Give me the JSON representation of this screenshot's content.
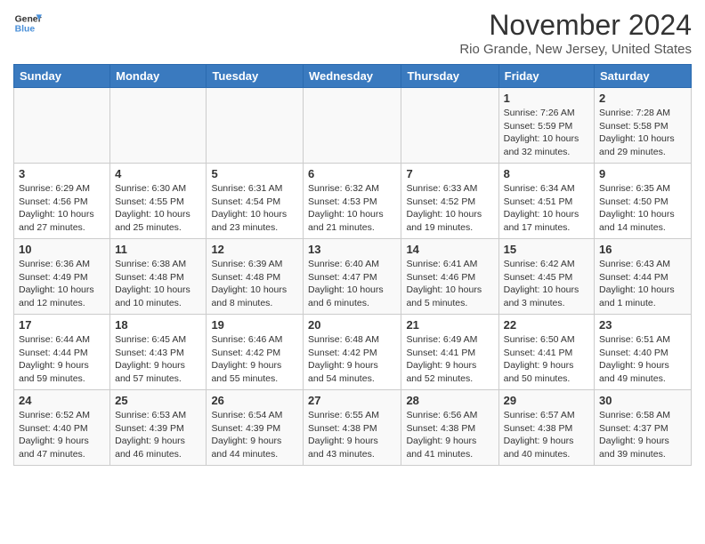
{
  "logo": {
    "line1": "General",
    "line2": "Blue"
  },
  "title": "November 2024",
  "location": "Rio Grande, New Jersey, United States",
  "days_header": [
    "Sunday",
    "Monday",
    "Tuesday",
    "Wednesday",
    "Thursday",
    "Friday",
    "Saturday"
  ],
  "weeks": [
    [
      {
        "day": "",
        "info": ""
      },
      {
        "day": "",
        "info": ""
      },
      {
        "day": "",
        "info": ""
      },
      {
        "day": "",
        "info": ""
      },
      {
        "day": "",
        "info": ""
      },
      {
        "day": "1",
        "info": "Sunrise: 7:26 AM\nSunset: 5:59 PM\nDaylight: 10 hours\nand 32 minutes."
      },
      {
        "day": "2",
        "info": "Sunrise: 7:28 AM\nSunset: 5:58 PM\nDaylight: 10 hours\nand 29 minutes."
      }
    ],
    [
      {
        "day": "3",
        "info": "Sunrise: 6:29 AM\nSunset: 4:56 PM\nDaylight: 10 hours\nand 27 minutes."
      },
      {
        "day": "4",
        "info": "Sunrise: 6:30 AM\nSunset: 4:55 PM\nDaylight: 10 hours\nand 25 minutes."
      },
      {
        "day": "5",
        "info": "Sunrise: 6:31 AM\nSunset: 4:54 PM\nDaylight: 10 hours\nand 23 minutes."
      },
      {
        "day": "6",
        "info": "Sunrise: 6:32 AM\nSunset: 4:53 PM\nDaylight: 10 hours\nand 21 minutes."
      },
      {
        "day": "7",
        "info": "Sunrise: 6:33 AM\nSunset: 4:52 PM\nDaylight: 10 hours\nand 19 minutes."
      },
      {
        "day": "8",
        "info": "Sunrise: 6:34 AM\nSunset: 4:51 PM\nDaylight: 10 hours\nand 17 minutes."
      },
      {
        "day": "9",
        "info": "Sunrise: 6:35 AM\nSunset: 4:50 PM\nDaylight: 10 hours\nand 14 minutes."
      }
    ],
    [
      {
        "day": "10",
        "info": "Sunrise: 6:36 AM\nSunset: 4:49 PM\nDaylight: 10 hours\nand 12 minutes."
      },
      {
        "day": "11",
        "info": "Sunrise: 6:38 AM\nSunset: 4:48 PM\nDaylight: 10 hours\nand 10 minutes."
      },
      {
        "day": "12",
        "info": "Sunrise: 6:39 AM\nSunset: 4:48 PM\nDaylight: 10 hours\nand 8 minutes."
      },
      {
        "day": "13",
        "info": "Sunrise: 6:40 AM\nSunset: 4:47 PM\nDaylight: 10 hours\nand 6 minutes."
      },
      {
        "day": "14",
        "info": "Sunrise: 6:41 AM\nSunset: 4:46 PM\nDaylight: 10 hours\nand 5 minutes."
      },
      {
        "day": "15",
        "info": "Sunrise: 6:42 AM\nSunset: 4:45 PM\nDaylight: 10 hours\nand 3 minutes."
      },
      {
        "day": "16",
        "info": "Sunrise: 6:43 AM\nSunset: 4:44 PM\nDaylight: 10 hours\nand 1 minute."
      }
    ],
    [
      {
        "day": "17",
        "info": "Sunrise: 6:44 AM\nSunset: 4:44 PM\nDaylight: 9 hours\nand 59 minutes."
      },
      {
        "day": "18",
        "info": "Sunrise: 6:45 AM\nSunset: 4:43 PM\nDaylight: 9 hours\nand 57 minutes."
      },
      {
        "day": "19",
        "info": "Sunrise: 6:46 AM\nSunset: 4:42 PM\nDaylight: 9 hours\nand 55 minutes."
      },
      {
        "day": "20",
        "info": "Sunrise: 6:48 AM\nSunset: 4:42 PM\nDaylight: 9 hours\nand 54 minutes."
      },
      {
        "day": "21",
        "info": "Sunrise: 6:49 AM\nSunset: 4:41 PM\nDaylight: 9 hours\nand 52 minutes."
      },
      {
        "day": "22",
        "info": "Sunrise: 6:50 AM\nSunset: 4:41 PM\nDaylight: 9 hours\nand 50 minutes."
      },
      {
        "day": "23",
        "info": "Sunrise: 6:51 AM\nSunset: 4:40 PM\nDaylight: 9 hours\nand 49 minutes."
      }
    ],
    [
      {
        "day": "24",
        "info": "Sunrise: 6:52 AM\nSunset: 4:40 PM\nDaylight: 9 hours\nand 47 minutes."
      },
      {
        "day": "25",
        "info": "Sunrise: 6:53 AM\nSunset: 4:39 PM\nDaylight: 9 hours\nand 46 minutes."
      },
      {
        "day": "26",
        "info": "Sunrise: 6:54 AM\nSunset: 4:39 PM\nDaylight: 9 hours\nand 44 minutes."
      },
      {
        "day": "27",
        "info": "Sunrise: 6:55 AM\nSunset: 4:38 PM\nDaylight: 9 hours\nand 43 minutes."
      },
      {
        "day": "28",
        "info": "Sunrise: 6:56 AM\nSunset: 4:38 PM\nDaylight: 9 hours\nand 41 minutes."
      },
      {
        "day": "29",
        "info": "Sunrise: 6:57 AM\nSunset: 4:38 PM\nDaylight: 9 hours\nand 40 minutes."
      },
      {
        "day": "30",
        "info": "Sunrise: 6:58 AM\nSunset: 4:37 PM\nDaylight: 9 hours\nand 39 minutes."
      }
    ]
  ]
}
